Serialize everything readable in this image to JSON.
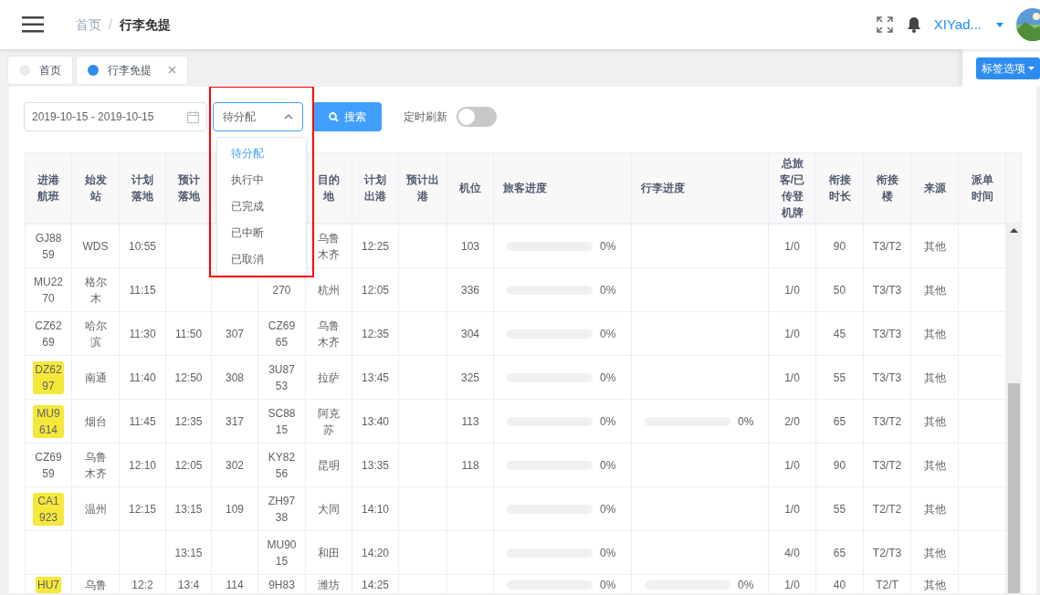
{
  "header": {
    "breadcrumb": [
      {
        "label": "首页",
        "current": false
      },
      {
        "label": "行李免提",
        "current": true
      }
    ],
    "separator": "/",
    "user": "XIYad..."
  },
  "tabs": [
    {
      "label": "首页",
      "selected": false,
      "closable": false
    },
    {
      "label": "行李免提",
      "selected": true,
      "closable": true
    }
  ],
  "tab_options": "标签选项",
  "filters": {
    "date_range": "2019-10-15 - 2019-10-15",
    "status_select": {
      "value": "待分配",
      "expanded": true,
      "options": [
        {
          "label": "待分配",
          "selected": true
        },
        {
          "label": "执行中",
          "selected": false
        },
        {
          "label": "已完成",
          "selected": false
        },
        {
          "label": "已中断",
          "selected": false
        },
        {
          "label": "已取消",
          "selected": false
        }
      ]
    },
    "search_button": "搜索",
    "auto_refresh": {
      "label": "定时刷新",
      "on": false
    }
  },
  "table": {
    "columns": [
      "进港航班",
      "始发站",
      "计划落地",
      "预计落地",
      "",
      "",
      "目的地",
      "计划出港",
      "预计出港",
      "机位",
      "旅客进度",
      "行李进度",
      "总旅客/已传登机牌",
      "衔接时长",
      "衔接楼",
      "来源",
      "派单时间"
    ],
    "rows": [
      {
        "highlight": false,
        "cells": [
          "GJ8859",
          "WDS",
          "10:55",
          "",
          "",
          "",
          "乌鲁木齐",
          "12:25",
          "",
          "103",
          {
            "level": 0,
            "text": "0%"
          },
          null,
          "1/0",
          "90",
          "T3/T2",
          "其他"
        ]
      },
      {
        "highlight": false,
        "cells": [
          "MU2270",
          "格尔木",
          "11:15",
          "",
          "",
          "270",
          "杭州",
          "12:05",
          "",
          "336",
          {
            "level": 0,
            "text": "0%"
          },
          null,
          "1/0",
          "50",
          "T3/T3",
          "其他"
        ]
      },
      {
        "highlight": false,
        "cells": [
          "CZ6269",
          "哈尔滨",
          "11:30",
          "11:50",
          "307",
          "CZ6965",
          "乌鲁木齐",
          "12:35",
          "",
          "304",
          {
            "level": 0,
            "text": "0%"
          },
          null,
          "1/0",
          "45",
          "T3/T3",
          "其他"
        ]
      },
      {
        "highlight": true,
        "cells": [
          "DZ6297",
          "南通",
          "11:40",
          "12:50",
          "308",
          "3U8753",
          "拉萨",
          "13:45",
          "",
          "325",
          {
            "level": 0,
            "text": "0%"
          },
          null,
          "1/0",
          "55",
          "T3/T3",
          "其他"
        ]
      },
      {
        "highlight": true,
        "cells": [
          "MU9614",
          "烟台",
          "11:45",
          "12:35",
          "317",
          "SC8815",
          "阿克苏",
          "13:40",
          "",
          "113",
          {
            "level": 0,
            "text": "0%"
          },
          {
            "level": 0,
            "text": "0%"
          },
          "2/0",
          "65",
          "T3/T2",
          "其他"
        ]
      },
      {
        "highlight": false,
        "cells": [
          "CZ6959",
          "乌鲁木齐",
          "12:10",
          "12:05",
          "302",
          "KY8256",
          "昆明",
          "13:35",
          "",
          "118",
          {
            "level": 0,
            "text": "0%"
          },
          null,
          "1/0",
          "90",
          "T3/T2",
          "其他"
        ]
      },
      {
        "highlight": true,
        "cells": [
          "CA1923",
          "温州",
          "12:15",
          "13:15",
          "109",
          "ZH9738",
          "大同",
          "14:10",
          "",
          "",
          {
            "level": 0,
            "text": "0%"
          },
          null,
          "1/0",
          "55",
          "T2/T2",
          "其他"
        ]
      },
      {
        "highlight": false,
        "cells": [
          "",
          "",
          "",
          "13:15",
          "",
          "MU9015",
          "和田",
          "14:20",
          "",
          "",
          {
            "level": 0,
            "text": "0%"
          },
          null,
          "4/0",
          "65",
          "T2/T3",
          "其他"
        ]
      },
      {
        "highlight": true,
        "cells": [
          "HU7",
          "乌鲁",
          "12:2",
          "13:4",
          "114",
          "9H83",
          "潍坊",
          "14:25",
          "",
          "",
          {
            "level": 0,
            "text": "0%"
          },
          {
            "level": 0,
            "text": "0%"
          },
          "1/0",
          "40",
          "T2/T",
          "其他"
        ]
      }
    ]
  }
}
